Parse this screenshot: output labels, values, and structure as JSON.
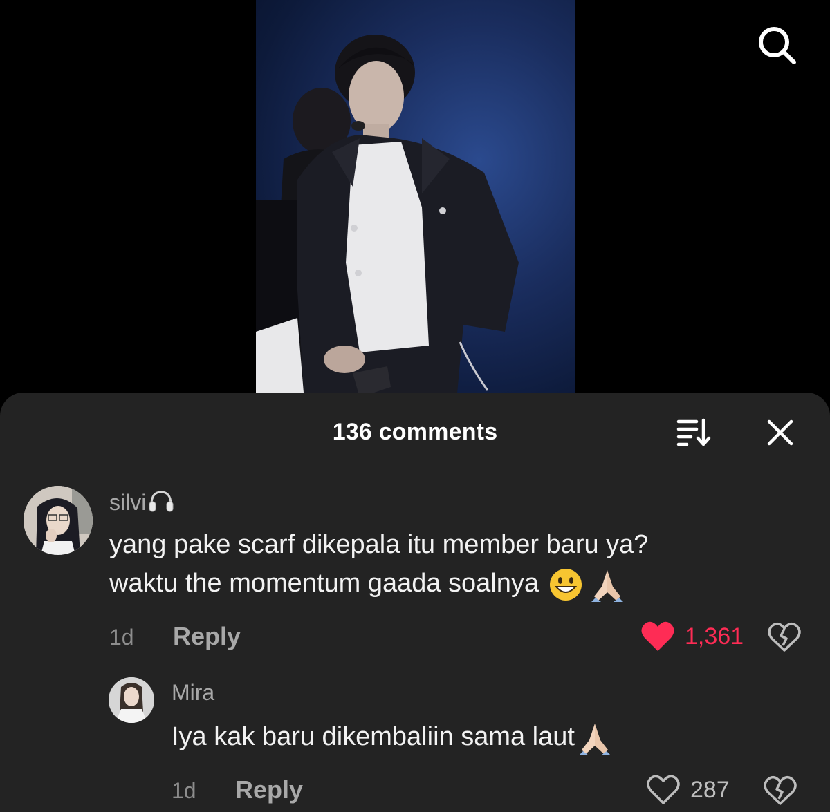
{
  "video": {
    "description_icon": "performer-video-thumbnail"
  },
  "top_bar": {
    "search_icon": "search-icon"
  },
  "comments_sheet": {
    "title": "136 comments",
    "sort_icon": "sort-icon",
    "close_icon": "close-icon"
  },
  "comments": [
    {
      "username": "silvi",
      "username_badge_icon": "headphones-icon",
      "line1": "yang pake scarf dikepala itu member baru ya?",
      "line2": "waktu the momentum gaada soalnya",
      "emojis": [
        "grinning-face-icon",
        "folded-hands-icon"
      ],
      "time": "1d",
      "reply_label": "Reply",
      "likes": "1,361",
      "liked": true,
      "like_color": "#fe2c55"
    },
    {
      "username": "Mira",
      "line1": "Iya kak baru dikembaliin sama laut",
      "emojis": [
        "folded-hands-icon"
      ],
      "time": "1d",
      "reply_label": "Reply",
      "likes": "287",
      "liked": false
    }
  ],
  "colors": {
    "sheet_bg": "#232323",
    "text_primary": "#f2f2f2",
    "text_secondary": "#a8a8a8",
    "like_active": "#fe2c55"
  }
}
